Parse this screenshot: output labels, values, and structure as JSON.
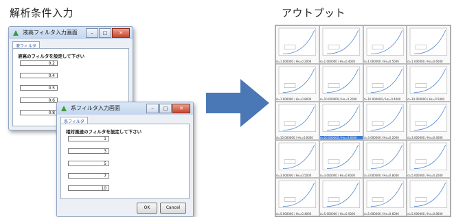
{
  "headings": {
    "left": "解析条件入力",
    "right": "アウトプット"
  },
  "window1": {
    "title": "液高フィルタ入力画面",
    "tab": "液フィルタ",
    "instruction": "液高のフィルタを設定して下さい",
    "values": [
      "0.2",
      "0.4",
      "0.5",
      "0.6",
      "0.8"
    ]
  },
  "window2": {
    "title": "系フィルタ入力画面",
    "tab": "系フィルタ",
    "instruction": "相対風速のフィルタを設定して下さい",
    "values": [
      "1",
      "3",
      "5",
      "7",
      "10"
    ],
    "ok_label": "OK",
    "cancel_label": "Cancel"
  },
  "output": {
    "rows": [
      {
        "labels": [
          "d=1.000000 / Hs=0.2000",
          "d=1.000000 / Hs=0.4000",
          "d=1.000000 / Hs=0.5000",
          "d=1.000000 / Hs=0.6000"
        ]
      },
      {
        "labels": [
          "d=1.000000 / Hs=0.8000",
          "d=10.000000 / Hs=0.2000",
          "d=10.000000 / Hs=0.4000",
          "d=10.000000 / Hs=0.5000"
        ]
      },
      {
        "labels": [
          "d=10.000000 / Hs=0.6000",
          "d=10.000000 / Hs=0.8000",
          "d=3.000000 / Hs=0.2000",
          "d=3.000000 / Hs=0.4000"
        ],
        "selected": 1
      },
      {
        "labels": [
          "d=3.000000 / Hs=0.5000",
          "d=3.000000 / Hs=0.6000",
          "d=3.000000 / Hs=0.8000",
          "d=5.000000 / Hs=0.2000"
        ]
      },
      {
        "labels": [
          "d=5.000000 / Hs=0.4000",
          "d=5.000000 / Hs=0.5000",
          "d=5.000000 / Hs=0.6000",
          "d=5.000000 / Hs=0.8000"
        ]
      }
    ]
  },
  "colors": {
    "arrow": "#4a78b6",
    "curve": "#5b8fd0"
  }
}
